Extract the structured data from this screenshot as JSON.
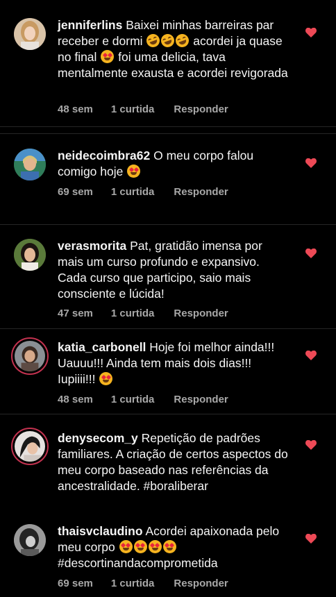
{
  "colors": {
    "background": "#000000",
    "text": "#f5f5f5",
    "meta": "#a8a8a8",
    "heart": "#ed4956",
    "story_ring": "#c3324f"
  },
  "comments": [
    {
      "username": "jenniferlins",
      "text_parts": [
        "Baixei minhas barreiras par receber e dormi ",
        " acordei ja quase no final ",
        " foi uma delicia, tava mentalmente exausta e acordei revigorada"
      ],
      "emojis": [
        "rolling-on-floor-laughing-emoji",
        "smiling-face-with-heart-eyes-emoji"
      ],
      "time": "48 sem",
      "likes": "1 curtida",
      "reply": "Responder",
      "liked": true
    },
    {
      "username": "neidecoimbra62",
      "text_parts": [
        "O meu corpo falou comigo hoje "
      ],
      "emojis": [
        "smiling-face-with-heart-eyes-emoji"
      ],
      "time": "69 sem",
      "likes": "1 curtida",
      "reply": "Responder",
      "liked": true
    },
    {
      "username": "verasmorita",
      "text_parts": [
        "Pat, gratidão imensa por mais um curso profundo e expansivo. Cada curso que participo, saio mais consciente e lúcida!"
      ],
      "time": "47 sem",
      "likes": "1 curtida",
      "reply": "Responder",
      "liked": true
    },
    {
      "username": "katia_carbonell",
      "text_parts": [
        "Hoje foi melhor ainda!!! Uauuu!!! Ainda tem mais dois dias!!! Iupiiii!!! "
      ],
      "emojis": [
        "smiling-face-with-heart-eyes-emoji"
      ],
      "time": "48 sem",
      "likes": "1 curtida",
      "reply": "Responder",
      "liked": true
    },
    {
      "username": "denysecom_y",
      "text_parts": [
        "Repetição de padrões familiares. A criação de certos aspectos do meu corpo baseado nas referências da ancestralidade. #boraliberar"
      ],
      "liked": true
    },
    {
      "username": "thaisvclaudino",
      "text_parts": [
        "Acordei apaixonada pelo meu corpo ",
        " #descortinandacomprometida"
      ],
      "emojis": [
        "smiling-face-with-heart-eyes-emoji"
      ],
      "time": "69 sem",
      "likes": "1 curtida",
      "reply": "Responder",
      "liked": true
    }
  ]
}
